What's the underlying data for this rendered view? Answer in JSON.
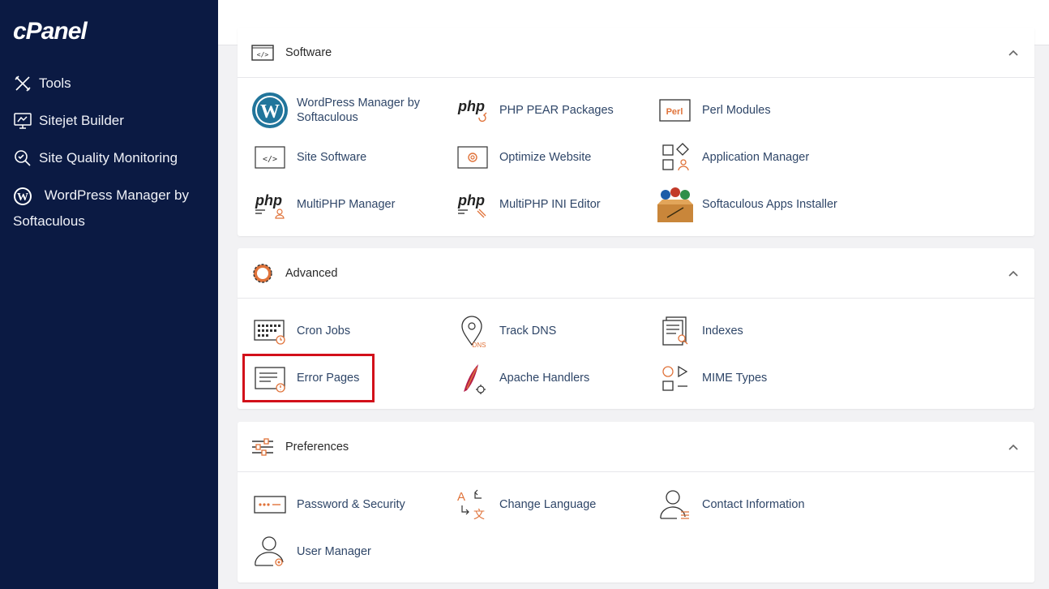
{
  "sidebar": {
    "logo": "cPanel",
    "items": [
      {
        "label": "Tools"
      },
      {
        "label": "Sitejet Builder"
      },
      {
        "label": "Site Quality Monitoring"
      },
      {
        "label": "WordPress Manager by Softaculous"
      }
    ]
  },
  "sections": {
    "software": {
      "title": "Software",
      "items": [
        {
          "label_line1": "WordPress Manager by",
          "label_line2": "Softaculous"
        },
        {
          "label": "PHP PEAR Packages"
        },
        {
          "label": "Perl Modules",
          "icon_text": "Perl"
        },
        {
          "label": "Site Software"
        },
        {
          "label": "Optimize Website"
        },
        {
          "label": "Application Manager"
        },
        {
          "label": "MultiPHP Manager"
        },
        {
          "label": "MultiPHP INI Editor"
        },
        {
          "label": "Softaculous Apps Installer"
        }
      ]
    },
    "advanced": {
      "title": "Advanced",
      "items": [
        {
          "label": "Cron Jobs"
        },
        {
          "label": "Track DNS",
          "icon_text": "DNS"
        },
        {
          "label": "Indexes"
        },
        {
          "label": "Error Pages"
        },
        {
          "label": "Apache Handlers"
        },
        {
          "label": "MIME Types"
        }
      ]
    },
    "preferences": {
      "title": "Preferences",
      "items": [
        {
          "label": "Password & Security"
        },
        {
          "label": "Change Language"
        },
        {
          "label": "Contact Information"
        },
        {
          "label": "User Manager"
        }
      ]
    }
  },
  "icon_text": {
    "php": "php",
    "code": "</>"
  },
  "colors": {
    "sidebar_bg": "#0b1a43",
    "accent_orange": "#e0733a",
    "link": "#2f4668",
    "highlight": "#d2101a"
  }
}
